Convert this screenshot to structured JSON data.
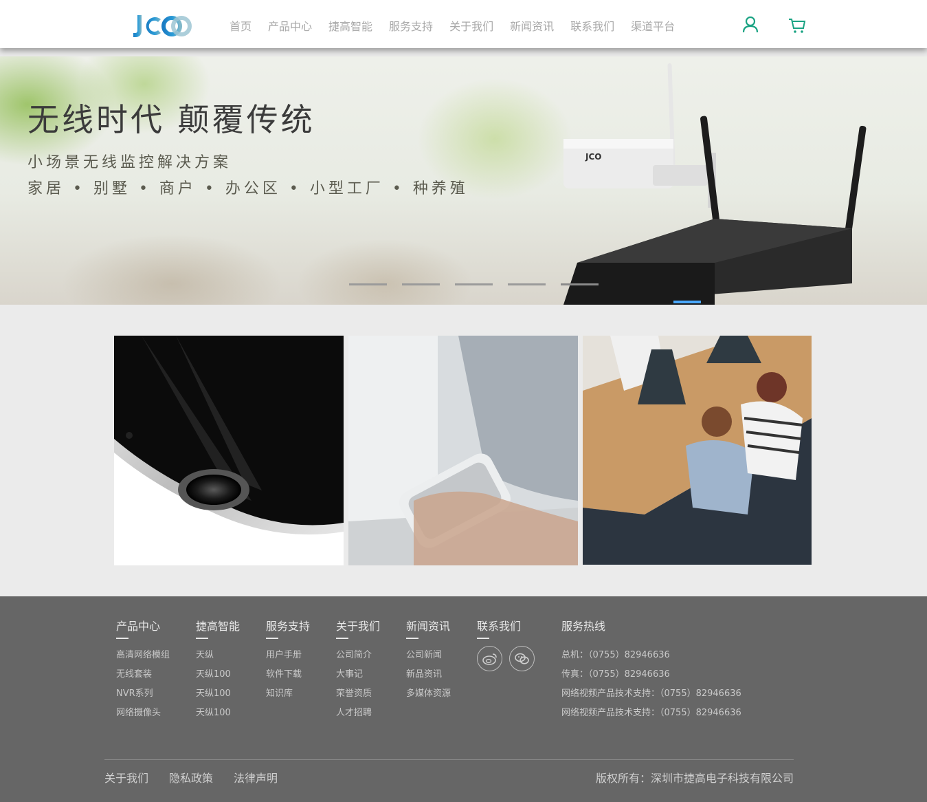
{
  "header": {
    "logo_text": "JCO",
    "nav": [
      {
        "label": "首页"
      },
      {
        "label": "产品中心"
      },
      {
        "label": "捷高智能"
      },
      {
        "label": "服务支持"
      },
      {
        "label": "关于我们"
      },
      {
        "label": "新闻资讯"
      },
      {
        "label": "联系我们"
      },
      {
        "label": "渠道平台"
      }
    ],
    "user_icon": "user-icon",
    "cart_icon": "cart-icon",
    "accent": "#1aa383"
  },
  "banner": {
    "title": "无线时代 颠覆传统",
    "subtitle1": "小场景无线监控解决方案",
    "subtitle2": "家居 • 别墅 • 商户 • 办公区 • 小型工厂 • 种养殖",
    "product_label": "JCO",
    "slides": 5,
    "active_slide": 5
  },
  "tiles": [
    {
      "name": "fisheye-camera-image"
    },
    {
      "name": "smartphone-hand-image"
    },
    {
      "name": "office-people-image"
    }
  ],
  "footer": {
    "columns": [
      {
        "title": "产品中心",
        "links": [
          "高清网络模组",
          "无线套装",
          "NVR系列",
          "网络摄像头"
        ]
      },
      {
        "title": "捷高智能",
        "links": [
          "天纵",
          "天纵100",
          "天纵100",
          "天纵100"
        ]
      },
      {
        "title": "服务支持",
        "links": [
          "用户手册",
          "软件下载",
          "知识库"
        ]
      },
      {
        "title": "关于我们",
        "links": [
          "公司简介",
          "大事记",
          "荣誉资质",
          "人才招聘"
        ]
      },
      {
        "title": "新闻资讯",
        "links": [
          "公司新闻",
          "新品资讯",
          "多媒体资源"
        ]
      }
    ],
    "contact": {
      "title": "联系我们",
      "icons": [
        "weibo-icon",
        "wechat-icon"
      ]
    },
    "hotline": {
      "title": "服务热线",
      "lines": [
        "总机：（0755）82946636",
        "传真：（0755）82946636",
        "网络视频产品技术支持：（0755）82946636",
        "网络视频产品技术支持：（0755）82946636"
      ]
    },
    "bottom_links": [
      "关于我们",
      "隐私政策",
      "法律声明"
    ],
    "copyright": "版权所有：深圳市捷高电子科技有限公司"
  }
}
